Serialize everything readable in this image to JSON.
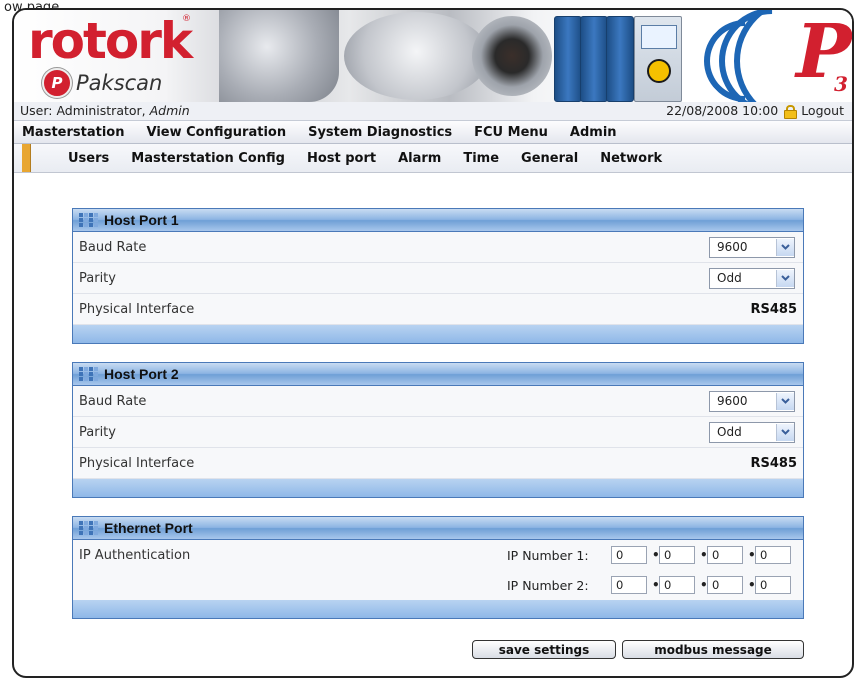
{
  "browser_title": "ow page",
  "brand": {
    "company": "rotork",
    "product": "Pakscan",
    "product_badge": "P",
    "p3_letter": "P",
    "p3_sub": "3"
  },
  "userbar": {
    "user_prefix": "User: Administrator, ",
    "user_role": "Admin",
    "datetime": "22/08/2008 10:00",
    "logout": "Logout"
  },
  "main_menu": [
    "Masterstation",
    "View Configuration",
    "System Diagnostics",
    "FCU Menu",
    "Admin"
  ],
  "sub_menu": [
    "Users",
    "Masterstation Config",
    "Host port",
    "Alarm",
    "Time",
    "General",
    "Network"
  ],
  "host_port_1": {
    "title": "Host Port 1",
    "baud_label": "Baud Rate",
    "baud_value": "9600",
    "parity_label": "Parity",
    "parity_value": "Odd",
    "interface_label": "Physical Interface",
    "interface_value": "RS485"
  },
  "host_port_2": {
    "title": "Host Port 2",
    "baud_label": "Baud Rate",
    "baud_value": "9600",
    "parity_label": "Parity",
    "parity_value": "Odd",
    "interface_label": "Physical Interface",
    "interface_value": "RS485"
  },
  "ethernet_port": {
    "title": "Ethernet Port",
    "auth_label": "IP Authentication",
    "ip1_label": "IP Number 1:",
    "ip1": [
      "0",
      "0",
      "0",
      "0"
    ],
    "ip2_label": "IP Number 2:",
    "ip2": [
      "0",
      "0",
      "0",
      "0"
    ]
  },
  "buttons": {
    "save": "save settings",
    "modbus": "modbus message"
  },
  "colors": {
    "brand_red": "#d2202f",
    "panel_blue": "#8cb4e3",
    "submenu_marker": "#e8a631"
  }
}
